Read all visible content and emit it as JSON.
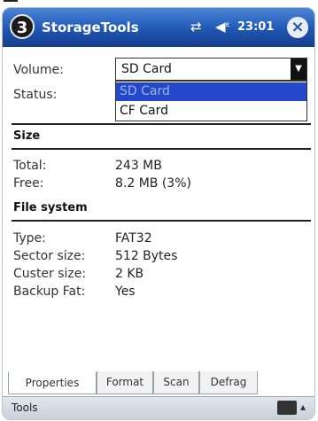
{
  "header": {
    "badge": "3",
    "app_title": "StorageTools",
    "time": "23:01",
    "close_label": "×"
  },
  "volume": {
    "label": "Volume:",
    "selected": "SD Card",
    "options": [
      "SD Card",
      "CF Card"
    ]
  },
  "status": {
    "label": "Status:"
  },
  "size": {
    "heading": "Size",
    "total_label": "Total:",
    "total_value": "243 MB",
    "free_label": "Free:",
    "free_value": "8.2 MB (3%)"
  },
  "filesystem": {
    "heading": "File system",
    "type_label": "Type:",
    "type_value": "FAT32",
    "sector_label": "Sector size:",
    "sector_value": "512 Bytes",
    "cluster_label": "Custer size:",
    "cluster_value": "2 KB",
    "backup_label": "Backup Fat:",
    "backup_value": "Yes"
  },
  "tabs": [
    {
      "label": "Properties"
    },
    {
      "label": "Format"
    },
    {
      "label": "Scan"
    },
    {
      "label": "Defrag"
    }
  ],
  "bottombar": {
    "tools": "Tools"
  },
  "colors": {
    "titlebar": "#1f56b3",
    "selection": "#2348c9"
  },
  "icons": [
    "connectivity-icon",
    "volume-icon",
    "close-icon",
    "keyboard-icon"
  ]
}
